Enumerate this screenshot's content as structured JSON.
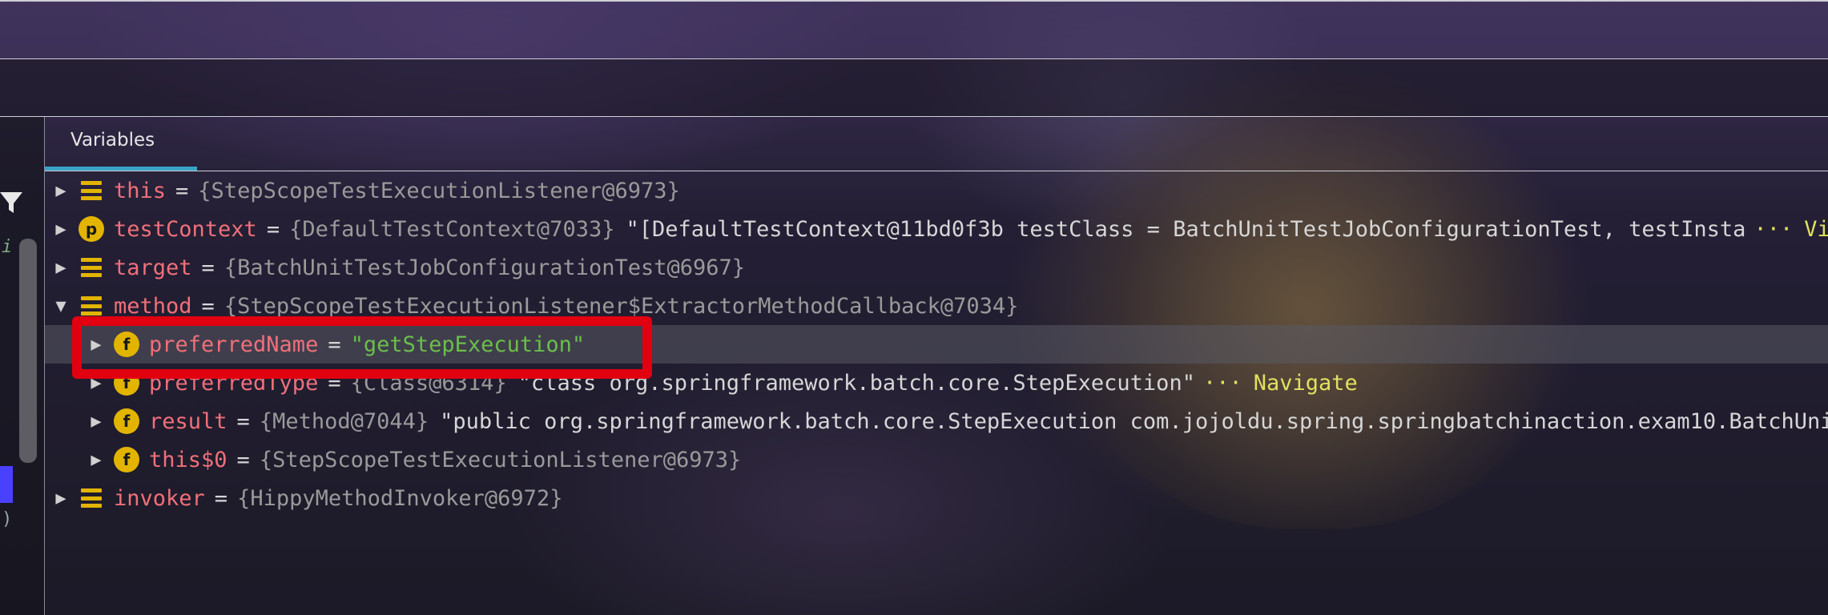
{
  "panel": {
    "tab_label": "Variables"
  },
  "sidebar_fragments": {
    "frag1": "i",
    "frag2": ")"
  },
  "colors": {
    "accent_tab": "#3aa3c8",
    "highlight_box": "#e00010",
    "icon_badge": "#e2b400",
    "var_name": "#f0707a",
    "string_value": "#6abf4b"
  },
  "rows": [
    {
      "expander": "▶",
      "icon": "field-lines-icon",
      "name": "this",
      "eq": "=",
      "type": "{StepScopeTestExecutionListener@6973}"
    },
    {
      "expander": "▶",
      "icon": "p-badge-icon",
      "icon_letter": "p",
      "name": "testContext",
      "eq": "=",
      "type": "{DefaultTestContext@7033}",
      "value": "\"[DefaultTestContext@11bd0f3b testClass = BatchUnitTestJobConfigurationTest, testInsta",
      "ellipsis": "···",
      "link": "View"
    },
    {
      "expander": "▶",
      "icon": "field-lines-icon",
      "name": "target",
      "eq": "=",
      "type": "{BatchUnitTestJobConfigurationTest@6967}"
    },
    {
      "expander": "▼",
      "icon": "field-lines-icon",
      "name": "method",
      "eq": "=",
      "type": "{StepScopeTestExecutionListener$ExtractorMethodCallback@7034}"
    },
    {
      "expander": "▶",
      "icon": "f-badge-icon",
      "icon_letter": "f",
      "name": "preferredName",
      "eq": "=",
      "value": "\"getStepExecution\""
    },
    {
      "expander": "▶",
      "icon": "f-badge-icon",
      "icon_letter": "f",
      "name": "preferredType",
      "eq": "=",
      "type": "{Class@6314}",
      "value": "\"class org.springframework.batch.core.StepExecution\"",
      "ellipsis": "···",
      "link": "Navigate"
    },
    {
      "expander": "▶",
      "icon": "f-badge-icon",
      "icon_letter": "f",
      "name": "result",
      "eq": "=",
      "type": "{Method@7044}",
      "value": "\"public org.springframework.batch.core.StepExecution com.jojoldu.spring.springbatchinaction.exam10.BatchUni"
    },
    {
      "expander": "▶",
      "icon": "f-badge-icon",
      "icon_letter": "f",
      "name": "this$0",
      "eq": "=",
      "type": "{StepScopeTestExecutionListener@6973}"
    },
    {
      "expander": "▶",
      "icon": "field-lines-icon",
      "name": "invoker",
      "eq": "=",
      "type": "{HippyMethodInvoker@6972}"
    }
  ]
}
